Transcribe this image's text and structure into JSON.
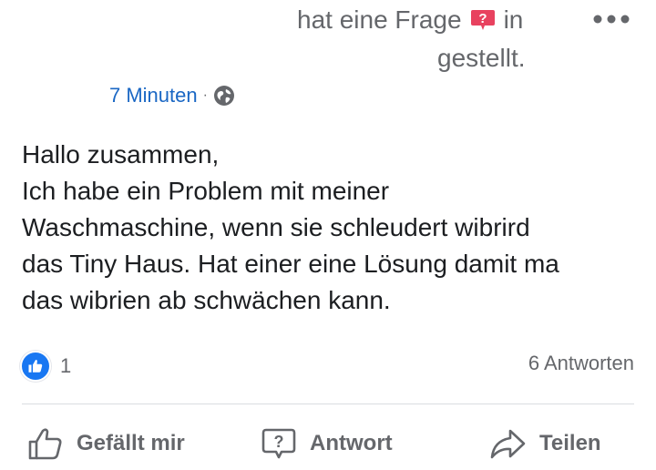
{
  "header": {
    "text_before_badge": "hat eine Frage",
    "text_after_badge": "in",
    "text_line2": "gestellt.",
    "badge_icon": "question-badge-icon",
    "badge_color": "#e8425f"
  },
  "meta": {
    "time": "7 Minuten",
    "separator": "·",
    "visibility_icon": "globe-icon"
  },
  "post": {
    "lines": [
      "Hallo zusammen,",
      "Ich habe ein Problem mit meiner",
      "Waschmaschine, wenn sie schleudert wibrird",
      "das Tiny Haus. Hat einer eine Lösung damit ma",
      "das wibrien ab schwächen kann."
    ]
  },
  "reactions": {
    "icon": "like-reaction-icon",
    "count": "1",
    "answers": "6 Antworten"
  },
  "actions": {
    "like": {
      "label": "Gefällt mir",
      "icon": "thumbs-up-icon"
    },
    "answer": {
      "label": "Antwort",
      "icon": "question-bubble-icon"
    },
    "share": {
      "label": "Teilen",
      "icon": "share-arrow-icon"
    }
  },
  "colors": {
    "accent": "#1877f2",
    "link": "#1a67c4",
    "secondary_text": "#65676b",
    "primary_text": "#1c1e21"
  }
}
